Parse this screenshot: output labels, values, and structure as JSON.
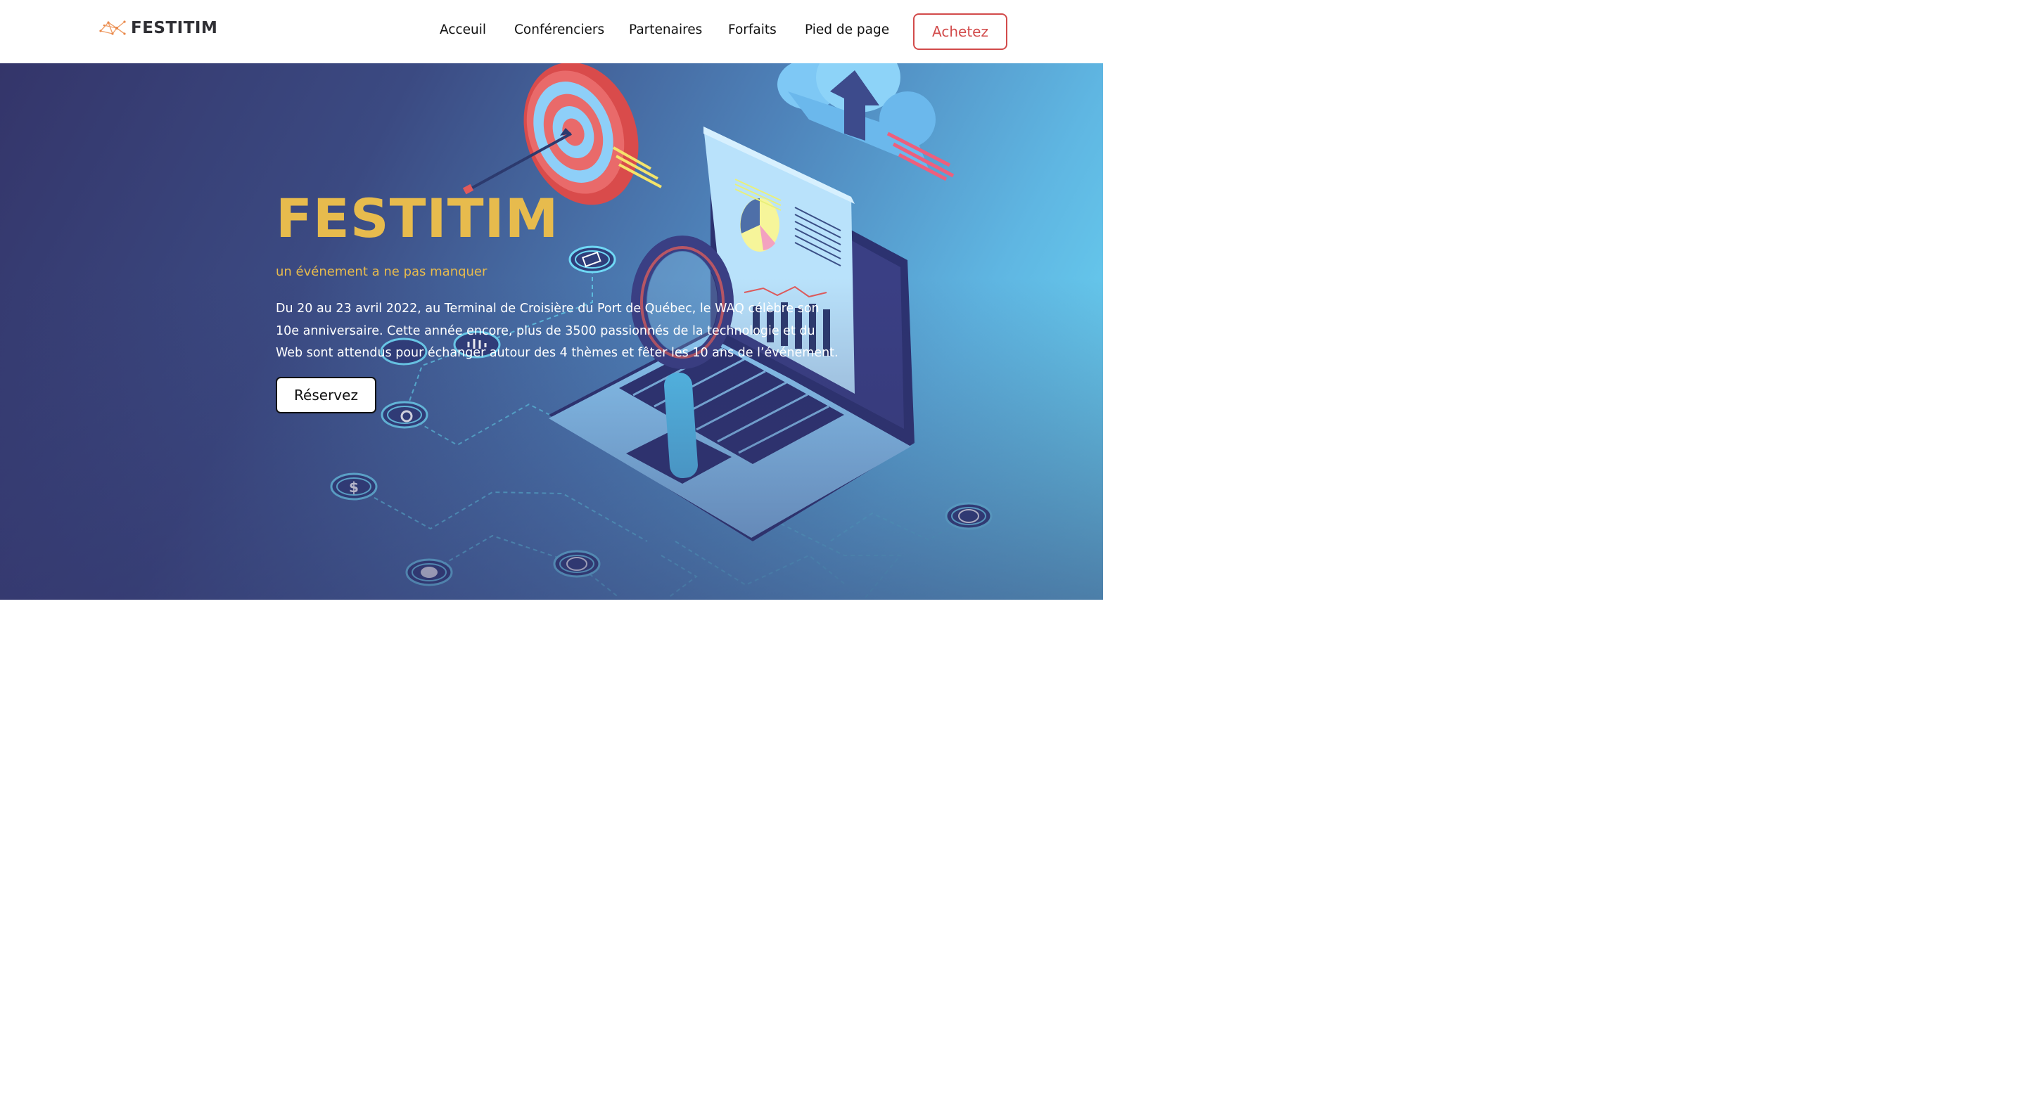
{
  "header": {
    "brand": "FESTITIM",
    "nav": [
      {
        "label": "Acceuil"
      },
      {
        "label": "Conférenciers"
      },
      {
        "label": "Partenaires"
      },
      {
        "label": "Forfaits"
      },
      {
        "label": "Pied de page"
      }
    ],
    "cta_label": "Achetez"
  },
  "hero": {
    "title": "FESTITIM",
    "subtitle": "un événement a ne pas manquer",
    "description": "Du 20 au 23 avril 2022, au Terminal de Croisière du Port de Québec, le WAQ célèbre son 10e anniversaire. Cette année encore, plus de 3500 passionnés de la technologie et du Web sont attendus pour échanger autour des 4 thèmes et fêter les 10 ans de l’événement.",
    "button_label": "Réservez",
    "illustration_icons": [
      "target-icon",
      "cloud-upload-icon",
      "laptop-icon",
      "magnifier-icon",
      "report-icon",
      "gear-icon",
      "dollar-icon",
      "pie-icon",
      "globe-icon",
      "chart-icon",
      "tablet-icon"
    ]
  },
  "colors": {
    "accent_gold": "#e7bb4d",
    "buy_red": "#d24b4b",
    "hero_dark": "#34356a",
    "hero_light": "#6cdcf7"
  }
}
